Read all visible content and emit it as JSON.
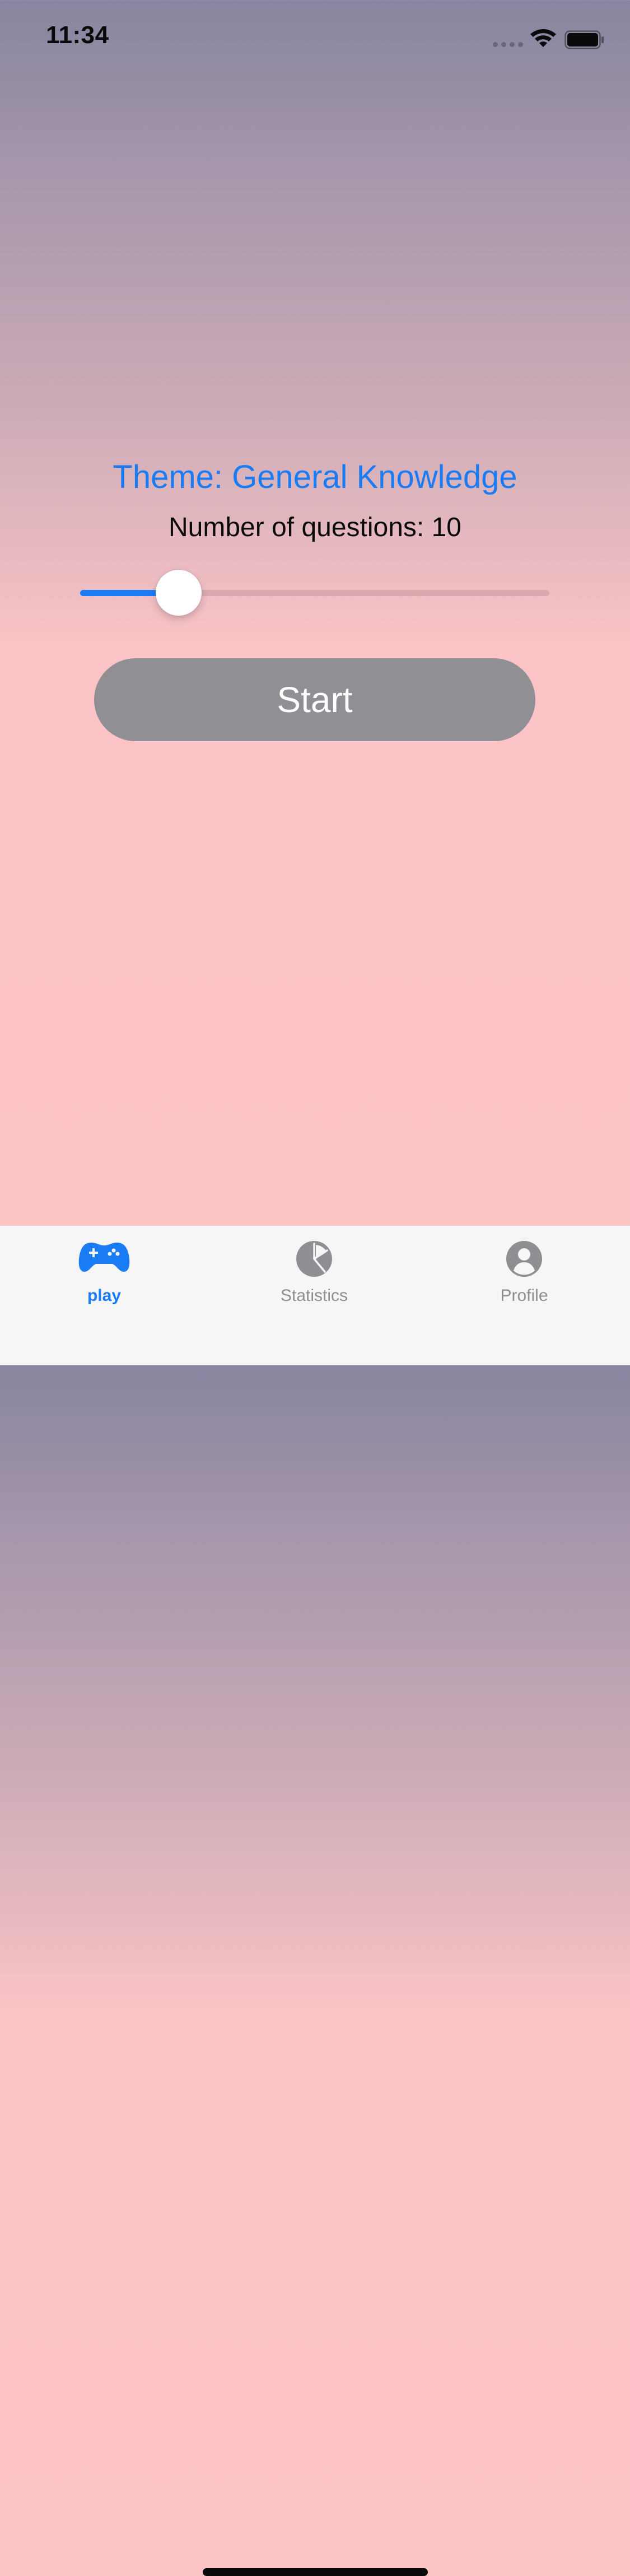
{
  "status_bar": {
    "time": "11:34"
  },
  "quiz_setup": {
    "theme_label": "Theme: General Knowledge",
    "question_count_label": "Number of questions: ",
    "question_count_value": "10",
    "slider_fill_fraction": 0.21,
    "start_label": "Start"
  },
  "tab_bar": {
    "items": [
      {
        "label": "play",
        "icon": "gamecontroller-icon",
        "selected": true
      },
      {
        "label": "Statistics",
        "icon": "chart-pie-icon",
        "selected": false
      },
      {
        "label": "Profile",
        "icon": "person-circle-icon",
        "selected": false
      }
    ]
  },
  "colors": {
    "accent": "#1a7cf5",
    "start_button": "#8f8f94",
    "inactive_tab": "#8e8e93",
    "background_top": "#87859f",
    "background_bottom": "#ffc5c6"
  }
}
